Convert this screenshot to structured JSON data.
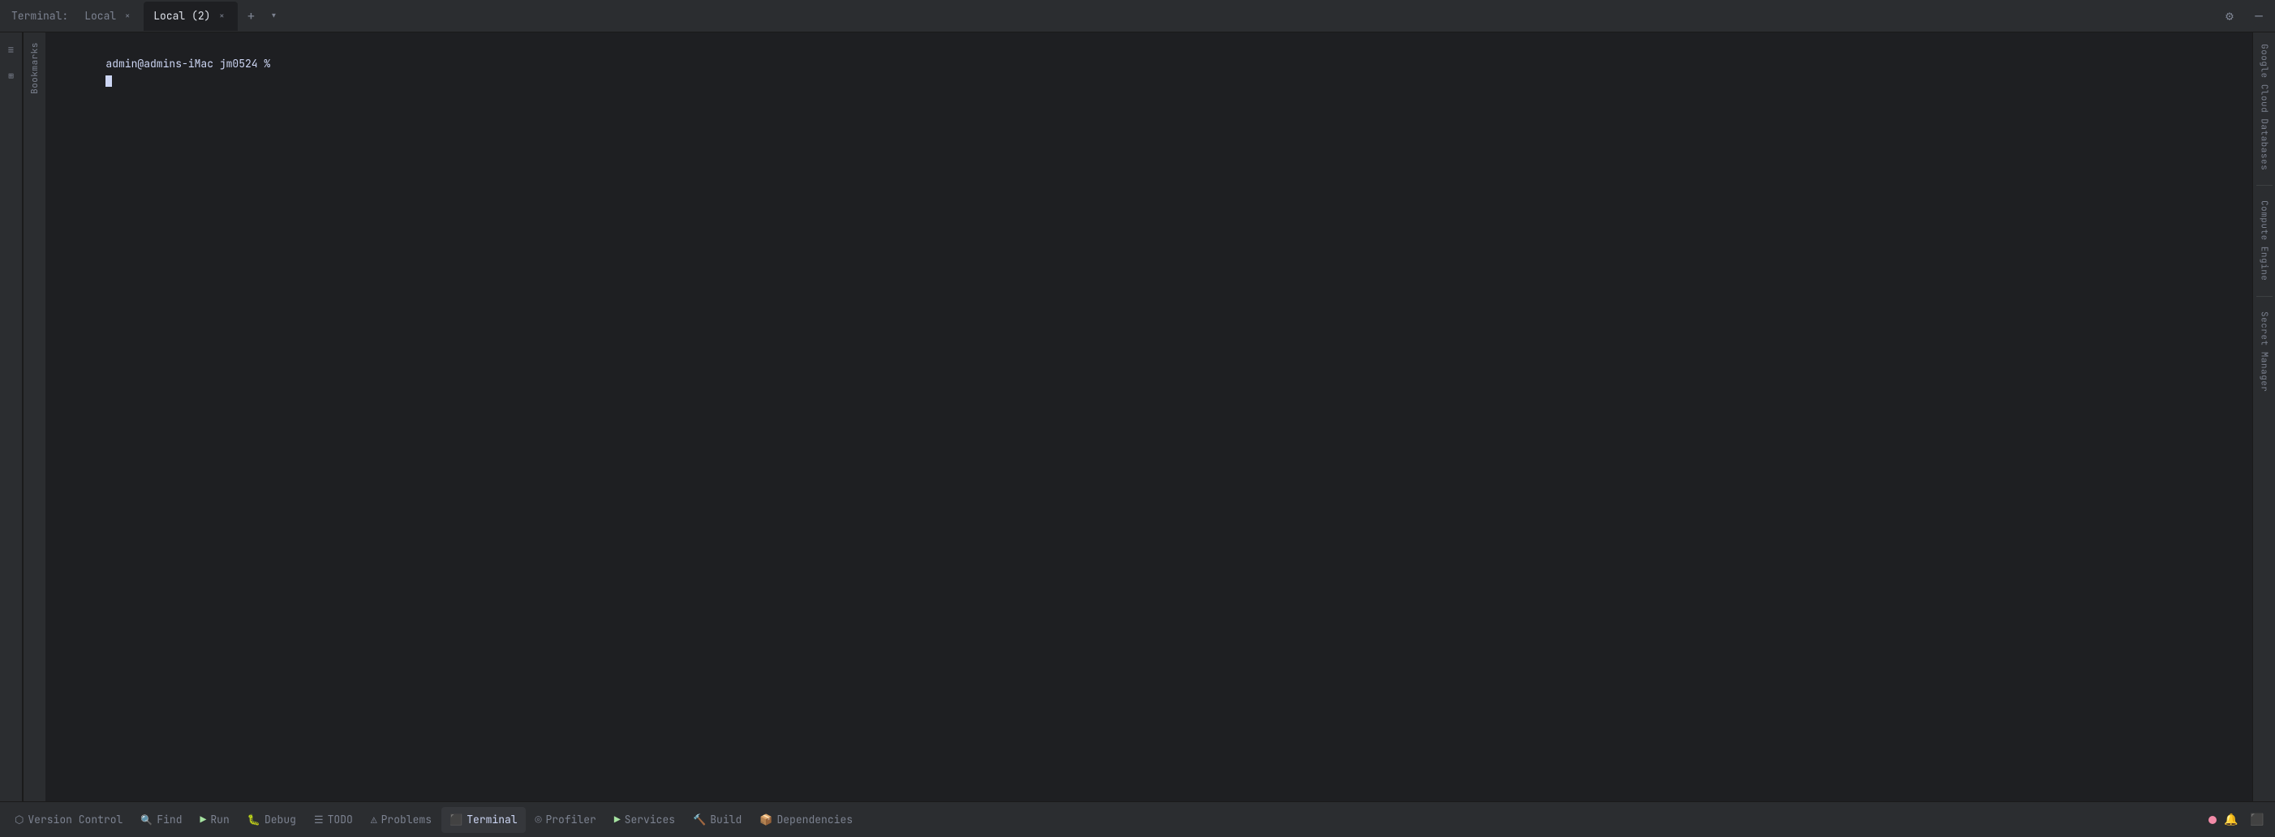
{
  "window": {
    "title": "Terminal"
  },
  "tabbar": {
    "label": "Terminal:",
    "tabs": [
      {
        "id": "local-1",
        "label": "Local",
        "active": false,
        "closable": true
      },
      {
        "id": "local-2",
        "label": "Local (2)",
        "active": true,
        "closable": true
      }
    ],
    "add_button": "+",
    "dropdown_button": "▾",
    "settings_icon": "⚙",
    "minimize_icon": "—"
  },
  "terminal": {
    "prompt": "admin@admins-iMac jm0524 %",
    "prompt_user": "admin@admins-iMac",
    "prompt_path": "jm0524",
    "prompt_char": " %"
  },
  "left_sidebar": {
    "panels": [
      {
        "id": "structure",
        "label": "Structure"
      },
      {
        "id": "bookmarks",
        "label": "Bookmarks"
      }
    ]
  },
  "right_sidebar": {
    "panels": [
      {
        "id": "google-cloud-databases",
        "label": "Google Cloud Databases"
      },
      {
        "id": "compute-engine",
        "label": "Compute Engine"
      },
      {
        "id": "secret-manager",
        "label": "Secret Manager"
      }
    ]
  },
  "statusbar": {
    "items": [
      {
        "id": "version-control",
        "label": "Version Control",
        "icon": "⬡"
      },
      {
        "id": "find",
        "label": "Find",
        "icon": "🔍"
      },
      {
        "id": "run",
        "label": "Run",
        "icon": "▶"
      },
      {
        "id": "debug",
        "label": "Debug",
        "icon": "🐛"
      },
      {
        "id": "todo",
        "label": "TODO",
        "icon": "☰"
      },
      {
        "id": "problems",
        "label": "Problems",
        "icon": "⚠"
      },
      {
        "id": "terminal",
        "label": "Terminal",
        "icon": "⬛",
        "active": true
      },
      {
        "id": "profiler",
        "label": "Profiler",
        "icon": "📊"
      },
      {
        "id": "services",
        "label": "Services",
        "icon": "▶"
      },
      {
        "id": "build",
        "label": "Build",
        "icon": "🔨"
      },
      {
        "id": "dependencies",
        "label": "Dependencies",
        "icon": "📦"
      }
    ],
    "right_icons": [
      {
        "id": "notifications",
        "icon": "🔔"
      },
      {
        "id": "layout",
        "icon": "⬛"
      }
    ]
  }
}
